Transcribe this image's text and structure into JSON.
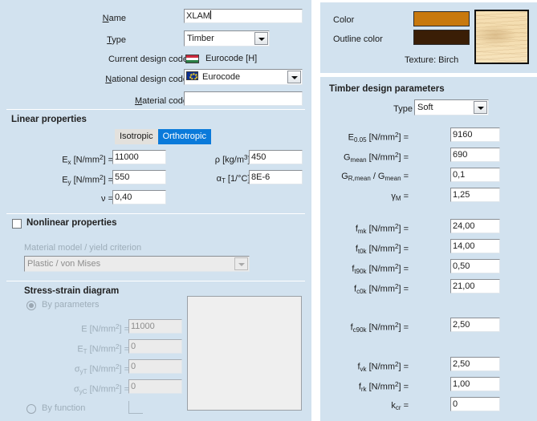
{
  "theme": {
    "panel_bg": "#d2e2ef",
    "accent": "#0a7ada",
    "field_bg": "#ffffff",
    "disabled_text": "#8d8d8d"
  },
  "left": {
    "name_label": "Name",
    "name_value": "XLAM",
    "type_label": "Type",
    "type_value": "Timber",
    "current_design_code_label": "Current design code",
    "current_design_code_value": "Eurocode [H]",
    "current_design_code_flag": "hungary-flag-icon",
    "national_design_code_label": "National design code",
    "national_design_code_value": "Eurocode",
    "national_design_code_flag": "eu-flag-icon",
    "material_code_label": "Material code",
    "material_code_value": "",
    "linear": {
      "title": "Linear properties",
      "toggle": {
        "isotropic": "Isotropic",
        "orthotropic": "Orthotropic",
        "selected": "Orthotropic"
      },
      "ex_label": "E",
      "ex_sub": "x",
      "ex_unit": "[N/mm",
      "ex_sup": "2",
      "ex_unit_end": "] =",
      "ex_value": "11000",
      "ey_sub": "y",
      "ey_value": "550",
      "nu_label": "ν  =",
      "nu_value": "0,40",
      "rho_label": "ρ [kg/m",
      "rho_sup": "3",
      "rho_label_end": "] =",
      "rho_value": "450",
      "alpha_label": "α",
      "alpha_sub": "T",
      "alpha_unit": "[1/°C] =",
      "alpha_value": "8E-6"
    },
    "nonlinear": {
      "title": "Nonlinear properties",
      "checked": false,
      "model_label": "Material model / yield criterion",
      "model_value": "Plastic / von Mises"
    },
    "stress_strain": {
      "title": "Stress-strain diagram",
      "by_parameters": "By parameters",
      "by_function": "By function",
      "selected": "By parameters",
      "e_label": "E [N/mm",
      "e_sup": "2",
      "e_label_end": "] =",
      "e_value": "11000",
      "et_label": "E",
      "et_sub": "T",
      "et_value": "0",
      "syt_label": "σ",
      "syt_sub": "yT",
      "syt_value": "0",
      "syc_label": "σ",
      "syc_sub": "yC",
      "syc_value": "0"
    }
  },
  "right": {
    "color_label": "Color",
    "color_value": "#c8790e",
    "outline_color_label": "Outline color",
    "outline_color_value": "#3a1e06",
    "texture_label": "Texture: Birch",
    "timber": {
      "title": "Timber design parameters",
      "type_label": "Type",
      "type_value": "Soft",
      "rows": [
        {
          "sym": "E",
          "sub": "0.05",
          "unit": true,
          "value": "9160"
        },
        {
          "sym": "G",
          "sub": "mean",
          "unit": true,
          "value": "690"
        },
        {
          "sym": "G",
          "sub": "R,mean",
          "ratio": true,
          "value": "0,1"
        },
        {
          "sym": "γ",
          "sub": "M",
          "unit": false,
          "value": "1,25"
        },
        {
          "sym": "f",
          "sub": "mk",
          "unit": true,
          "value": "24,00"
        },
        {
          "sym": "f",
          "sub": "t0k",
          "unit": true,
          "value": "14,00"
        },
        {
          "sym": "f",
          "sub": "t90k",
          "unit": true,
          "value": "0,50"
        },
        {
          "sym": "f",
          "sub": "c0k",
          "unit": true,
          "value": "21,00"
        },
        {
          "sym": "f",
          "sub": "c90k",
          "unit": true,
          "value": "2,50"
        },
        {
          "sym": "f",
          "sub": "vk",
          "unit": true,
          "value": "2,50"
        },
        {
          "sym": "f",
          "sub": "rk",
          "unit": true,
          "value": "1,00"
        },
        {
          "sym": "k",
          "sub": "cr",
          "unit": false,
          "value": "0"
        }
      ],
      "unit_open": "[N/mm",
      "unit_sup": "2",
      "unit_close": "] =",
      "ratio_mid": "/ G",
      "ratio_sub2": "mean",
      "eq": "="
    }
  }
}
